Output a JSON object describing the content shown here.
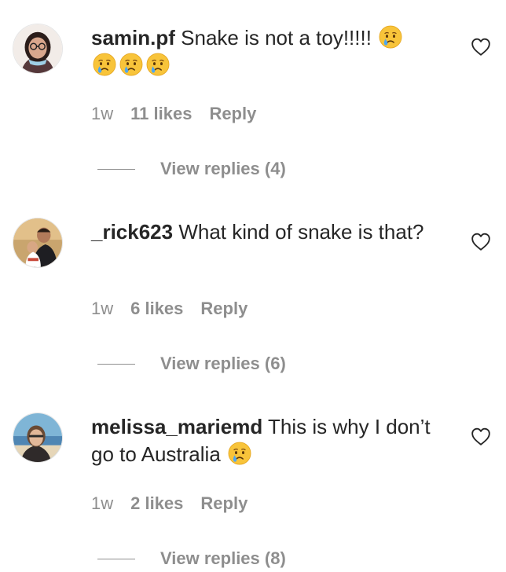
{
  "comments": [
    {
      "username": "samin.pf",
      "text": "Snake is not a toy!!!!!",
      "emoji_name": "crying-face-emoji",
      "time": "1w",
      "likes": "11 likes",
      "reply_label": "Reply",
      "view_replies": "View replies (4)"
    },
    {
      "username": "_rick623",
      "text": "What kind of snake is that?",
      "time": "1w",
      "likes": "6 likes",
      "reply_label": "Reply",
      "view_replies": "View replies (6)"
    },
    {
      "username": "melissa_mariemd",
      "text": "This is why I don’t go to Australia",
      "emoji_name": "crying-face-emoji",
      "time": "1w",
      "likes": "2 likes",
      "reply_label": "Reply",
      "view_replies": "View replies (8)"
    }
  ],
  "colors": {
    "text": "#262626",
    "muted": "#8e8e8e",
    "background": "#ffffff"
  }
}
